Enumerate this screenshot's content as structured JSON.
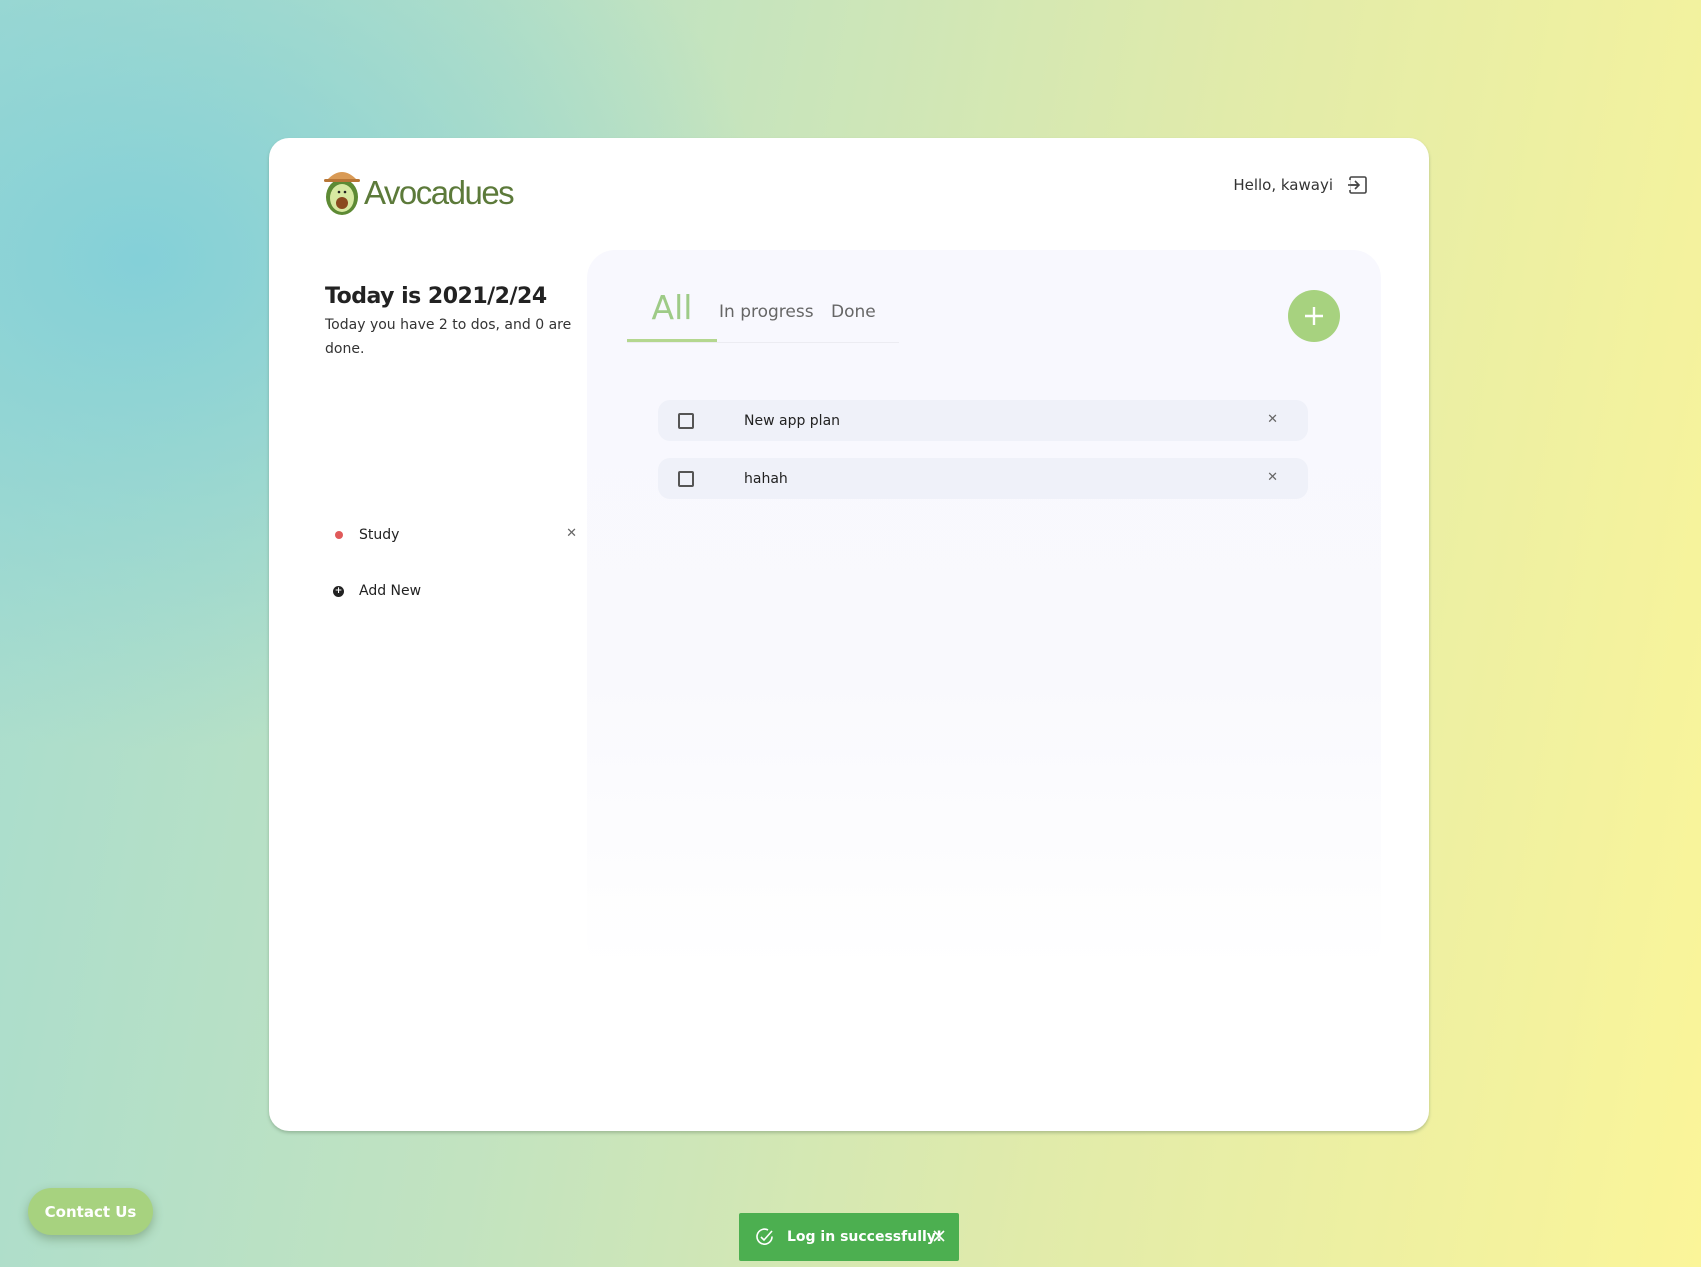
{
  "app": {
    "name": "Avocadues"
  },
  "header": {
    "greeting": "Hello, kawayi",
    "logout_icon": "logout-icon"
  },
  "today": {
    "title": "Today is 2021/2/24",
    "summary": "Today you have 2 to dos, and 0 are done."
  },
  "categories": {
    "items": [
      {
        "label": "Study",
        "color": "#e05a5a"
      }
    ],
    "add_label": "Add New"
  },
  "tabs": [
    {
      "label": "All",
      "active": true
    },
    {
      "label": "In progress",
      "active": false
    },
    {
      "label": "Done",
      "active": false
    }
  ],
  "todos": [
    {
      "label": "New app plan",
      "done": false
    },
    {
      "label": "hahah",
      "done": false
    }
  ],
  "contact": {
    "label": "Contact Us"
  },
  "toast": {
    "message": "Log in successfully!"
  },
  "colors": {
    "accent": "#a7d27f",
    "toast": "#4caf50",
    "brand_text": "#5c7a3a"
  }
}
